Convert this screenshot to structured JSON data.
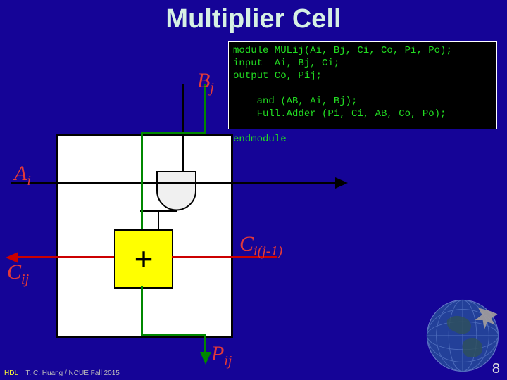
{
  "title": "Multiplier Cell",
  "code": "module MULij(Ai, Bj, Ci, Co, Pi, Po);\ninput  Ai, Bj, Ci;\noutput Co, Pij;\n\n    and (AB, Ai, Bj);\n    Full.Adder (Pi, Ci, AB, Co, Po);\n\nendmodule",
  "labels": {
    "Bj_html": "B<sub>j</sub>",
    "Ai_html": "A<sub>i</sub>",
    "Cij_html": "C<sub>ij</sub>",
    "Ci_jm1_html": "C<sub>i(j-1)</sub>",
    "Pij_html": "P<sub>ij</sub>",
    "plus": "+"
  },
  "footer": {
    "hdl": "HDL",
    "rest": "T. C. Huang / NCUE  Fall 2015"
  },
  "pagenum": "8",
  "chart_data": {
    "type": "diagram",
    "title": "Multiplier Cell",
    "description": "Single multiplier cell: AND gate feeding one input of a full adder (+). Inputs Ai, Bj, Ci(j-1) and Pij-in; outputs Cij and Pij.",
    "nodes": [
      {
        "id": "and",
        "type": "AND gate",
        "inputs": [
          "Ai",
          "Bj"
        ],
        "output": "AB"
      },
      {
        "id": "adder",
        "type": "Full Adder (+)",
        "inputs": [
          "AB",
          "Ci(j-1)",
          "Pi_in"
        ],
        "outputs": [
          "Cij",
          "Pij"
        ]
      }
    ],
    "edges": [
      {
        "from": "Bj",
        "to": "and"
      },
      {
        "from": "Ai",
        "to": "and"
      },
      {
        "from": "and",
        "to": "adder"
      },
      {
        "from": "Ci(j-1)",
        "to": "adder"
      },
      {
        "from": "adder",
        "to": "Cij"
      },
      {
        "from": "adder",
        "to": "Pij"
      }
    ],
    "verilog": "module MULij(Ai, Bj, Ci, Co, Pi, Po); input Ai, Bj, Ci; output Co, Pij; and (AB, Ai, Bj); Full.Adder (Pi, Ci, AB, Co, Po); endmodule"
  }
}
